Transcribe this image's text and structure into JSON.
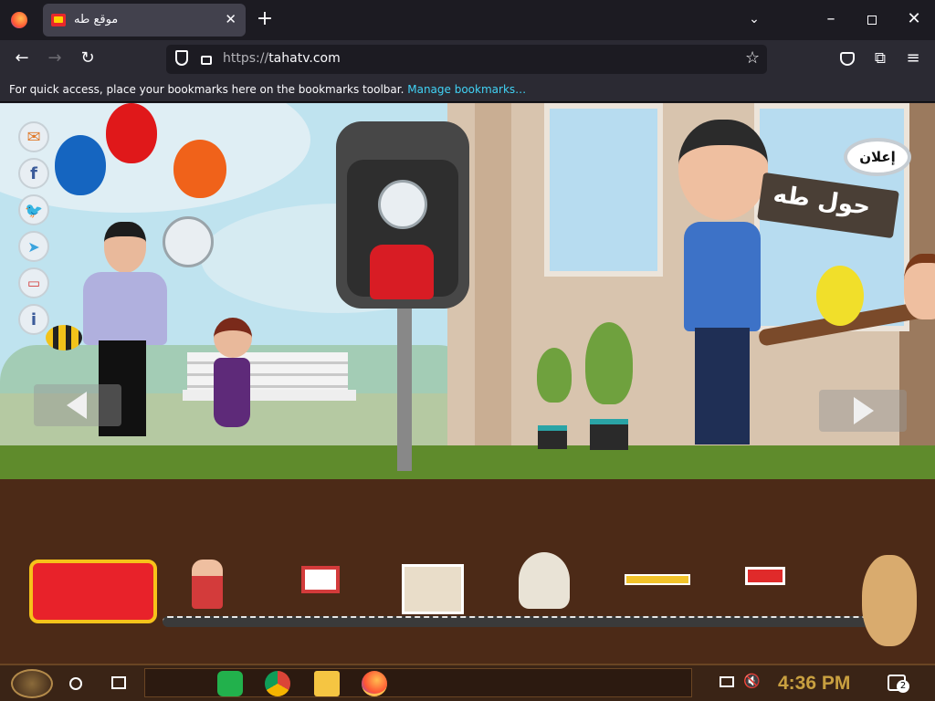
{
  "browser": {
    "tab_title": "موقع طه",
    "url_protocol": "https://",
    "url_host": "tahatv.com",
    "new_tab_label": "+",
    "bookmarks_message": "For quick access, place your bookmarks here on the bookmarks toolbar.",
    "bookmarks_link": "Manage bookmarks…"
  },
  "scene": {
    "sign_text": "حول طه",
    "ad_label": "إعلان"
  },
  "taskbar": {
    "clock": "4:36 PM",
    "notification_count": "2"
  },
  "colors": {
    "tab_bg": "#42414d",
    "toolbar_bg": "#2b2a33",
    "link": "#41d2f5",
    "clock": "#c9a040"
  }
}
